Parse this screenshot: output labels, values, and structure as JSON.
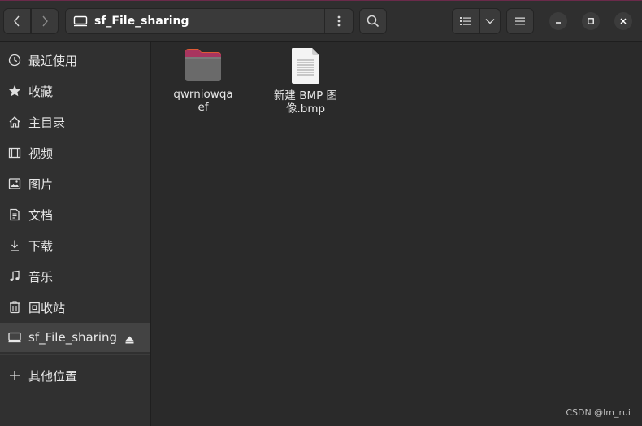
{
  "header": {
    "location": "sf_File_sharing"
  },
  "sidebar": {
    "items": [
      {
        "label": "最近使用",
        "icon": "clock-icon"
      },
      {
        "label": "收藏",
        "icon": "star-icon"
      },
      {
        "label": "主目录",
        "icon": "home-icon"
      },
      {
        "label": "视频",
        "icon": "video-icon"
      },
      {
        "label": "图片",
        "icon": "image-icon"
      },
      {
        "label": "文档",
        "icon": "document-icon"
      },
      {
        "label": "下载",
        "icon": "download-icon"
      },
      {
        "label": "音乐",
        "icon": "music-icon"
      },
      {
        "label": "回收站",
        "icon": "trash-icon"
      },
      {
        "label": "sf_File_sharing",
        "icon": "drive-icon",
        "active": true
      },
      {
        "label": "其他位置",
        "icon": "plus-icon"
      }
    ]
  },
  "files": [
    {
      "name": "qwrniowqaef",
      "type": "folder"
    },
    {
      "name": "新建 BMP 图像.bmp",
      "type": "image-file"
    }
  ],
  "watermark": "CSDN @lm_rui"
}
